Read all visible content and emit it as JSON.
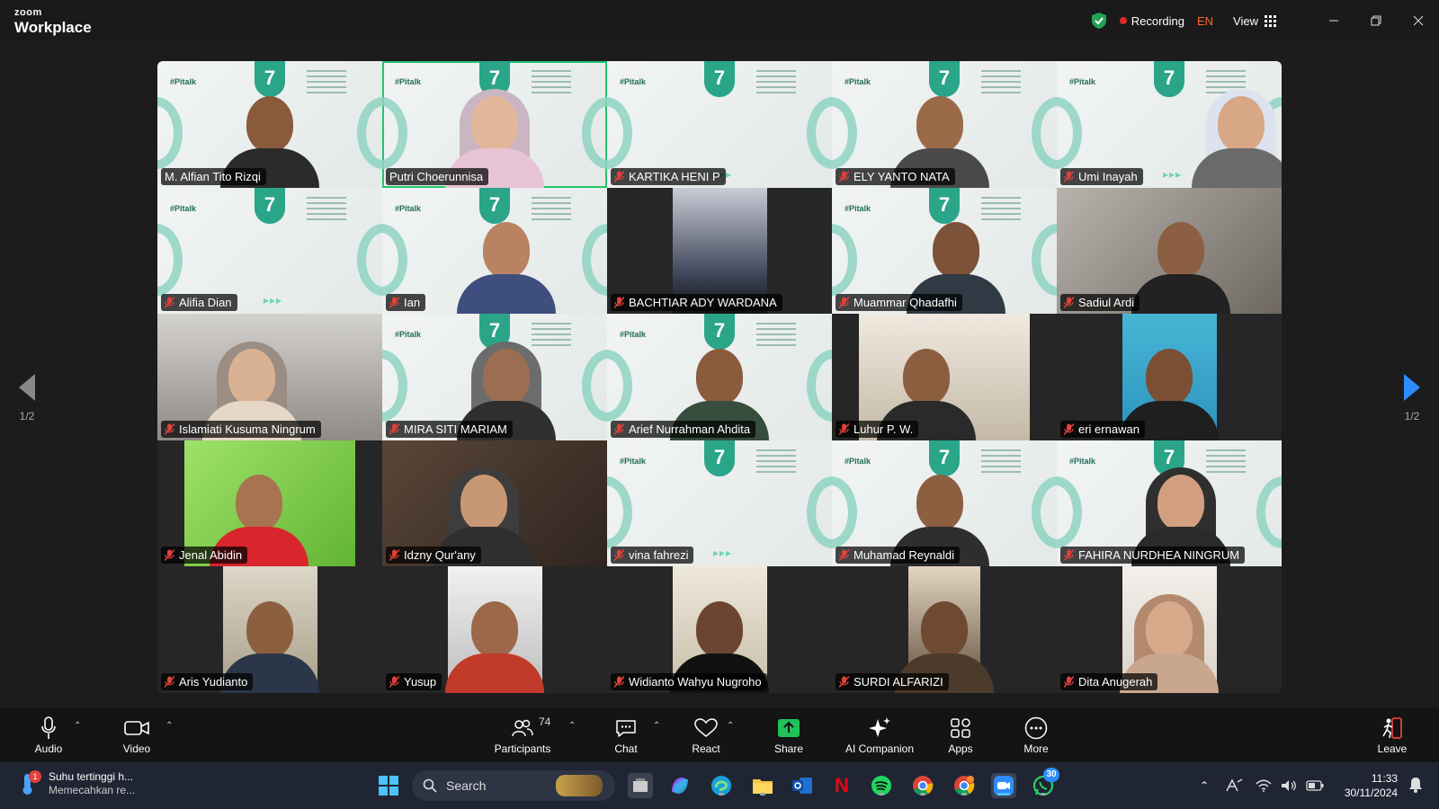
{
  "app": {
    "brand_small": "zoom",
    "brand_name": "Workplace"
  },
  "titlebar": {
    "recording_label": "Recording",
    "language": "EN",
    "view_label": "View"
  },
  "pagination": {
    "left": "1/2",
    "right": "1/2"
  },
  "participants": [
    {
      "name": "M. Alfian Tito Rizqi",
      "muted": false,
      "speaking": false
    },
    {
      "name": "Putri Choerunnisa",
      "muted": false,
      "speaking": true
    },
    {
      "name": "KARTIKA HENI P",
      "muted": true,
      "speaking": false
    },
    {
      "name": "ELY YANTO NATA",
      "muted": true,
      "speaking": false
    },
    {
      "name": "Umi Inayah",
      "muted": true,
      "speaking": false
    },
    {
      "name": "Alifia Dian",
      "muted": true,
      "speaking": false
    },
    {
      "name": "Ian",
      "muted": true,
      "speaking": false
    },
    {
      "name": "BACHTIAR ADY WARDANA",
      "muted": true,
      "speaking": false
    },
    {
      "name": "Muammar Qhadafhi",
      "muted": true,
      "speaking": false
    },
    {
      "name": "Sadiul Ardi",
      "muted": true,
      "speaking": false
    },
    {
      "name": "Islamiati Kusuma Ningrum",
      "muted": true,
      "speaking": false
    },
    {
      "name": "MIRA SITI MARIAM",
      "muted": true,
      "speaking": false
    },
    {
      "name": "Arief Nurrahman Ahdita",
      "muted": true,
      "speaking": false
    },
    {
      "name": "Luhur P. W.",
      "muted": true,
      "speaking": false
    },
    {
      "name": "eri ernawan",
      "muted": true,
      "speaking": false
    },
    {
      "name": "Jenal Abidin",
      "muted": true,
      "speaking": false
    },
    {
      "name": "Idzny Qur'any",
      "muted": true,
      "speaking": false
    },
    {
      "name": "vina fahrezi",
      "muted": true,
      "speaking": false
    },
    {
      "name": "Muhamad Reynaldi",
      "muted": true,
      "speaking": false
    },
    {
      "name": "FAHIRA NURDHEA NINGRUM",
      "muted": true,
      "speaking": false
    },
    {
      "name": "Aris Yudianto",
      "muted": true,
      "speaking": false
    },
    {
      "name": "Yusup",
      "muted": true,
      "speaking": false
    },
    {
      "name": "Widianto Wahyu Nugroho",
      "muted": true,
      "speaking": false
    },
    {
      "name": "SURDI ALFARIZI",
      "muted": true,
      "speaking": false
    },
    {
      "name": "Dita Anugerah",
      "muted": true,
      "speaking": false
    }
  ],
  "virtual_background": {
    "tag": "#Pitalk",
    "number": "7"
  },
  "toolbar": {
    "audio": "Audio",
    "video": "Video",
    "participants": "Participants",
    "participant_count": "74",
    "chat": "Chat",
    "react": "React",
    "share": "Share",
    "ai_companion": "AI Companion",
    "apps": "Apps",
    "more": "More",
    "leave": "Leave"
  },
  "taskbar": {
    "weather_title": "Suhu tertinggi h...",
    "weather_sub": "Memecahkan re...",
    "weather_badge": "1",
    "search_placeholder": "Search",
    "whatsapp_badge": "30",
    "time": "11:33",
    "date": "30/11/2024"
  },
  "colors": {
    "accent_green": "#22c56e",
    "record_red": "#e02828",
    "lang_orange": "#ff6b2b",
    "mute_red": "#e0413a"
  }
}
